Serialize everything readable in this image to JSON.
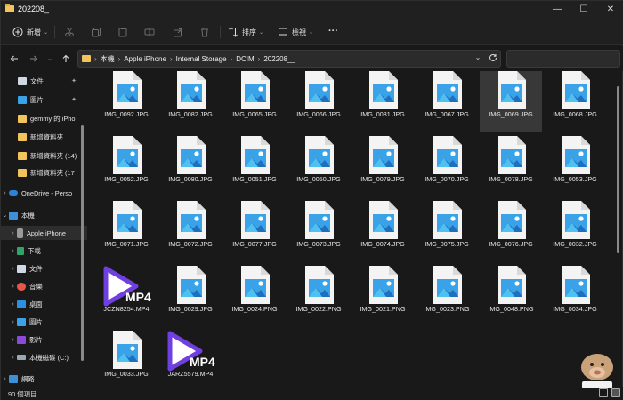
{
  "window": {
    "title": "202208_",
    "controls": {
      "minimize": "—",
      "maximize": "☐",
      "close": "✕"
    }
  },
  "commandbar": {
    "new_label": "新增",
    "sort_label": "排序",
    "view_label": "檢視",
    "more_label": "···"
  },
  "addressbar": {
    "crumbs": [
      "本機",
      "Apple iPhone",
      "Internal Storage",
      "DCIM",
      "202208__"
    ]
  },
  "sidebar": {
    "items": [
      {
        "label": "文件",
        "pinned": true,
        "icon": "documents-icon"
      },
      {
        "label": "圖片",
        "pinned": true,
        "icon": "pictures-icon"
      },
      {
        "label": "gemmy 的 iPho",
        "pinned": false,
        "icon": "folder-icon"
      },
      {
        "label": "新增資料夾",
        "pinned": false,
        "icon": "folder-icon"
      },
      {
        "label": "新增資料夾 (14)",
        "pinned": false,
        "icon": "folder-icon"
      },
      {
        "label": "新增資料夾 (17",
        "pinned": false,
        "icon": "folder-icon"
      },
      {
        "label": "OneDrive - Perso",
        "pinned": false,
        "icon": "cloud-icon"
      },
      {
        "label": "本機",
        "pinned": false,
        "icon": "pc-icon"
      },
      {
        "label": "Apple iPhone",
        "pinned": false,
        "icon": "phone-icon"
      },
      {
        "label": "下載",
        "pinned": false,
        "icon": "download-icon"
      },
      {
        "label": "文件",
        "pinned": false,
        "icon": "documents-icon"
      },
      {
        "label": "音樂",
        "pinned": false,
        "icon": "music-icon"
      },
      {
        "label": "桌面",
        "pinned": false,
        "icon": "desktop-icon"
      },
      {
        "label": "圖片",
        "pinned": false,
        "icon": "pictures-icon"
      },
      {
        "label": "影片",
        "pinned": false,
        "icon": "videos-icon"
      },
      {
        "label": "本機磁碟 (C:)",
        "pinned": false,
        "icon": "drive-icon"
      },
      {
        "label": "網路",
        "pinned": false,
        "icon": "network-icon"
      }
    ]
  },
  "files": [
    {
      "name": "IMG_0092.JPG",
      "type": "image"
    },
    {
      "name": "IMG_0082.JPG",
      "type": "image"
    },
    {
      "name": "IMG_0065.JPG",
      "type": "image"
    },
    {
      "name": "IMG_0066.JPG",
      "type": "image"
    },
    {
      "name": "IMG_0081.JPG",
      "type": "image"
    },
    {
      "name": "IMG_0067.JPG",
      "type": "image"
    },
    {
      "name": "IMG_0069.JPG",
      "type": "image",
      "selected": true
    },
    {
      "name": "IMG_0068.JPG",
      "type": "image"
    },
    {
      "name": "IMG_0052.JPG",
      "type": "image"
    },
    {
      "name": "IMG_0080.JPG",
      "type": "image"
    },
    {
      "name": "IMG_0051.JPG",
      "type": "image"
    },
    {
      "name": "IMG_0050.JPG",
      "type": "image"
    },
    {
      "name": "IMG_0079.JPG",
      "type": "image"
    },
    {
      "name": "IMG_0070.JPG",
      "type": "image"
    },
    {
      "name": "IMG_0078.JPG",
      "type": "image"
    },
    {
      "name": "IMG_0053.JPG",
      "type": "image"
    },
    {
      "name": "IMG_0071.JPG",
      "type": "image"
    },
    {
      "name": "IMG_0072.JPG",
      "type": "image"
    },
    {
      "name": "IMG_0077.JPG",
      "type": "image"
    },
    {
      "name": "IMG_0073.JPG",
      "type": "image"
    },
    {
      "name": "IMG_0074.JPG",
      "type": "image"
    },
    {
      "name": "IMG_0075.JPG",
      "type": "image"
    },
    {
      "name": "IMG_0076.JPG",
      "type": "image"
    },
    {
      "name": "IMG_0032.JPG",
      "type": "image"
    },
    {
      "name": "JCZN8254.MP4",
      "type": "video",
      "badge": "MP4"
    },
    {
      "name": "IMG_0029.JPG",
      "type": "image"
    },
    {
      "name": "IMG_0024.PNG",
      "type": "image"
    },
    {
      "name": "IMG_0022.PNG",
      "type": "image"
    },
    {
      "name": "IMG_0021.PNG",
      "type": "image"
    },
    {
      "name": "IMG_0023.PNG",
      "type": "image"
    },
    {
      "name": "IMG_0048.PNG",
      "type": "image"
    },
    {
      "name": "IMG_0034.JPG",
      "type": "image"
    },
    {
      "name": "IMG_0033.JPG",
      "type": "image"
    },
    {
      "name": "JARZ5579.MP4",
      "type": "video",
      "badge": "MP4"
    }
  ],
  "status": {
    "item_count": "90 個項目"
  },
  "colors": {
    "background": "#191919",
    "toolbar": "#202020",
    "folder": "#f2c55c",
    "image_sky": "#3aa3e8",
    "image_mountain_dark": "#1f6fbf",
    "video_play": "#6f3fe0"
  }
}
